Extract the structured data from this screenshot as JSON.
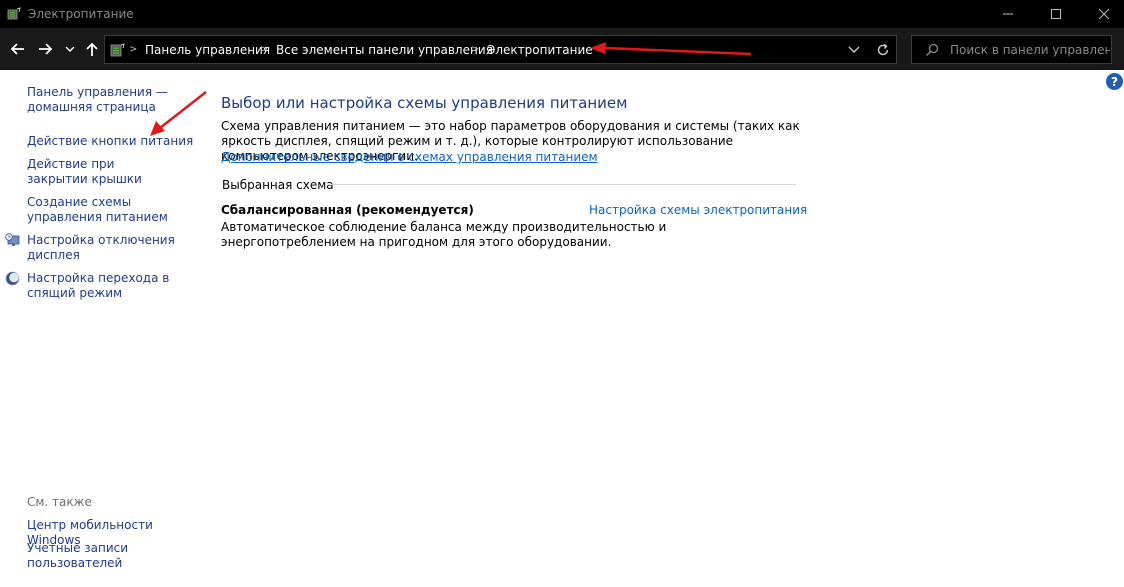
{
  "window": {
    "title": "Электропитание"
  },
  "nav": {
    "breadcrumbs": [
      {
        "label": "Панель управления"
      },
      {
        "label": "Все элементы панели управления"
      },
      {
        "label": "Электропитание"
      }
    ],
    "search_placeholder": "Поиск в панели управления"
  },
  "help": {
    "label": "?"
  },
  "sidebar": {
    "items": [
      {
        "label": "Панель управления — домашняя страница",
        "icon": null
      },
      {
        "label": "Действие кнопки питания",
        "icon": null
      },
      {
        "label": "Действие при закрытии крышки",
        "icon": null
      },
      {
        "label": "Создание схемы управления питанием",
        "icon": null
      },
      {
        "label": "Настройка отключения дисплея",
        "icon": "display-clock-icon"
      },
      {
        "label": "Настройка перехода в спящий режим",
        "icon": "sleep-moon-icon"
      }
    ],
    "see_also": {
      "heading": "См. также",
      "items": [
        {
          "label": "Центр мобильности Windows"
        },
        {
          "label": "Учетные записи пользователей"
        }
      ]
    }
  },
  "main": {
    "title": "Выбор или настройка схемы управления питанием",
    "description": "Схема управления питанием — это набор параметров оборудования и системы (таких как яркость дисплея, спящий режим и т. д.), которые контролируют использование компьютером электроэнергии.",
    "more_link": "Дополнительные сведения о схемах управления питанием",
    "selected_plan_label": "Выбранная схема",
    "plan": {
      "name": "Сбалансированная (рекомендуется)",
      "settings_link": "Настройка схемы электропитания",
      "description": "Автоматическое соблюдение баланса между производительностью и энергопотреблением на пригодном для этого оборудовании."
    }
  },
  "colors": {
    "titlebar_bg": "#000000",
    "navbar_bg": "#191919",
    "link": "#1f3a93",
    "accent_link": "#0b63c4",
    "annotation_arrow": "#e0191b"
  }
}
